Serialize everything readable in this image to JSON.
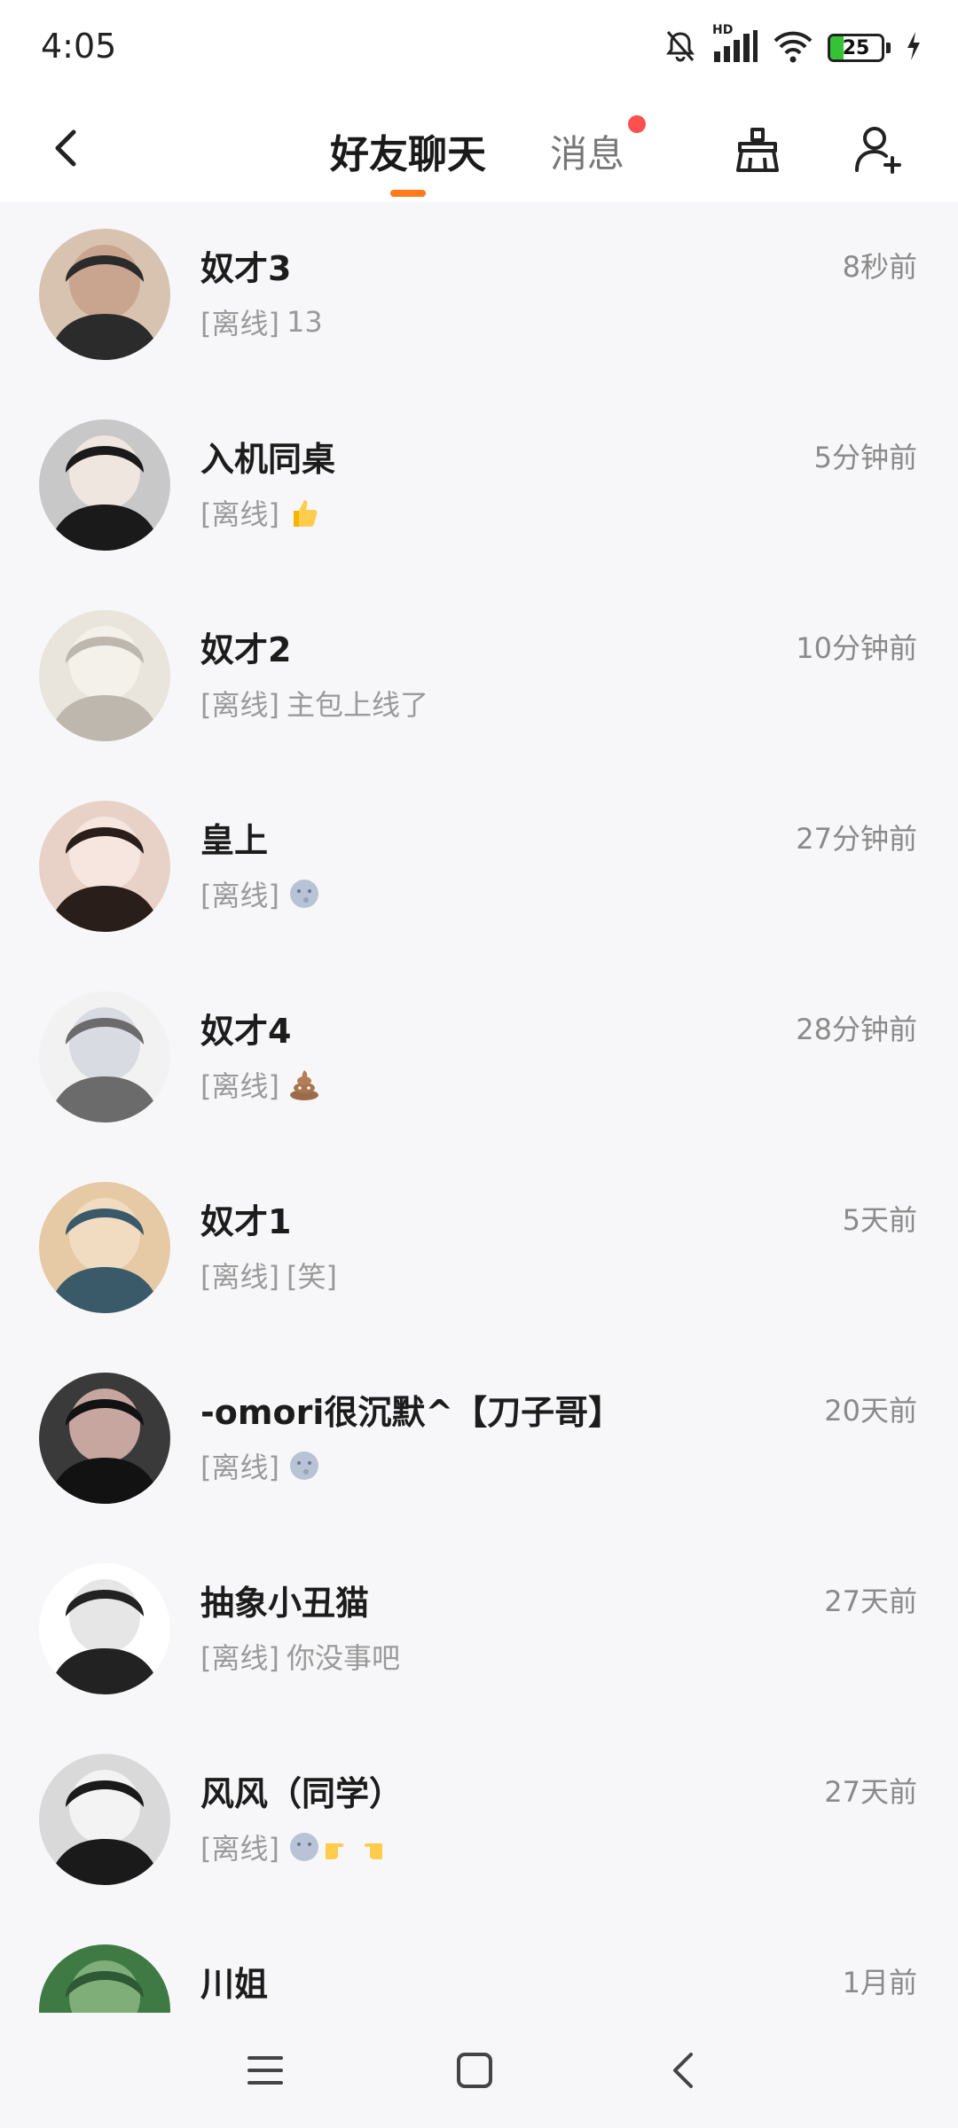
{
  "status_bar": {
    "time": "4:05",
    "hd_label": "HD",
    "battery_percent": "25",
    "battery_level": 0.25,
    "icons": [
      "bell-muted-icon",
      "signal-icon",
      "wifi-icon",
      "battery-icon",
      "charging-icon"
    ]
  },
  "header": {
    "tab_friends": "好友聊天",
    "tab_messages": "消息",
    "messages_has_unread": true,
    "accent_color": "#ff7a1a",
    "dot_color": "#ff5050"
  },
  "chats": [
    {
      "name": "奴才3",
      "time": "8秒前",
      "status": "[离线]",
      "message": "13",
      "emoji": ""
    },
    {
      "name": "入机同桌",
      "time": "5分钟前",
      "status": "[离线]",
      "message": "",
      "emoji": "thumbs-up"
    },
    {
      "name": "奴才2",
      "time": "10分钟前",
      "status": "[离线]",
      "message": "主包上线了",
      "emoji": ""
    },
    {
      "name": "皇上",
      "time": "27分钟前",
      "status": "[离线]",
      "message": "",
      "emoji": "moon-face"
    },
    {
      "name": "奴才4",
      "time": "28分钟前",
      "status": "[离线]",
      "message": "",
      "emoji": "poop"
    },
    {
      "name": "奴才1",
      "time": "5天前",
      "status": "[离线]",
      "message": "[笑]",
      "emoji": ""
    },
    {
      "name": "-omori很沉默^【刀子哥】",
      "time": "20天前",
      "status": "[离线]",
      "message": "",
      "emoji": "moon-face"
    },
    {
      "name": "抽象小丑猫",
      "time": "27天前",
      "status": "[离线]",
      "message": "你没事吧",
      "emoji": ""
    },
    {
      "name": "风风（同学）",
      "time": "27天前",
      "status": "[离线]",
      "message": "",
      "emoji": "moon-face-pointing"
    },
    {
      "name": "川姐",
      "time": "1月前",
      "status": "",
      "message": "",
      "emoji": ""
    }
  ]
}
